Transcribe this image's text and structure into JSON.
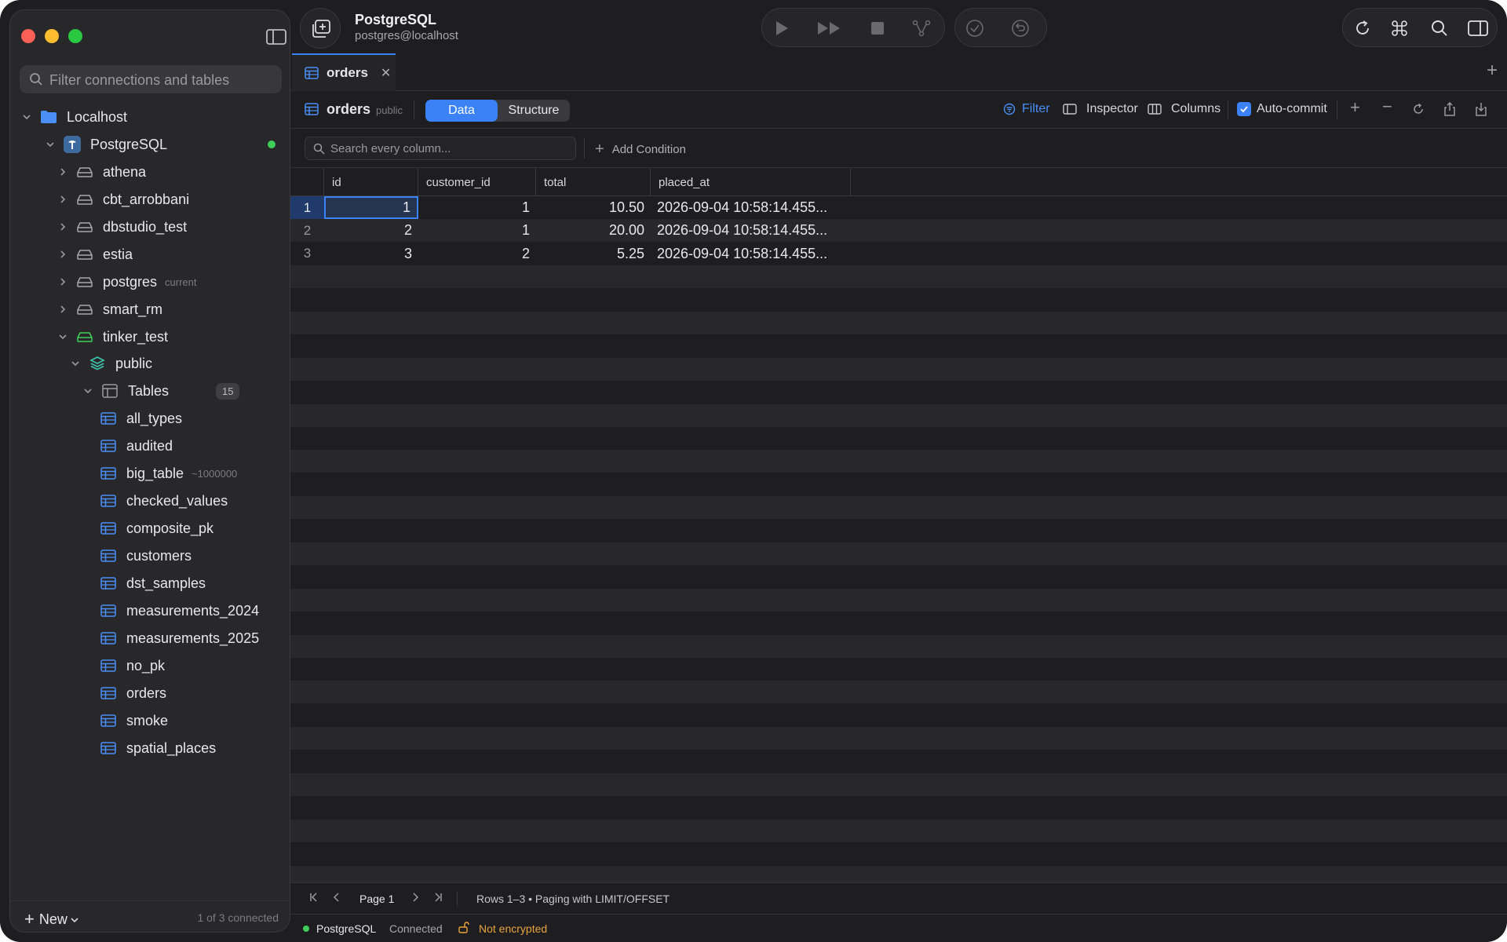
{
  "colors": {
    "accent": "#3b82f6",
    "connected": "#3fce5b",
    "warning": "#e8a33d"
  },
  "titlebar": {
    "connection_name": "PostgreSQL",
    "connection_subtitle": "postgres@localhost"
  },
  "sidebar": {
    "filter_placeholder": "Filter connections and tables",
    "group": "Localhost",
    "connection": "PostgreSQL",
    "databases": [
      {
        "name": "athena",
        "note": ""
      },
      {
        "name": "cbt_arrobbani",
        "note": ""
      },
      {
        "name": "dbstudio_test",
        "note": ""
      },
      {
        "name": "estia",
        "note": ""
      },
      {
        "name": "postgres",
        "note": "current"
      },
      {
        "name": "smart_rm",
        "note": ""
      },
      {
        "name": "tinker_test",
        "note": ""
      }
    ],
    "schema": "public",
    "tables_label": "Tables",
    "tables_count": "15",
    "tables": [
      {
        "name": "all_types",
        "note": ""
      },
      {
        "name": "audited",
        "note": ""
      },
      {
        "name": "big_table",
        "note": "~1000000"
      },
      {
        "name": "checked_values",
        "note": ""
      },
      {
        "name": "composite_pk",
        "note": ""
      },
      {
        "name": "customers",
        "note": ""
      },
      {
        "name": "dst_samples",
        "note": ""
      },
      {
        "name": "measurements_2024",
        "note": ""
      },
      {
        "name": "measurements_2025",
        "note": ""
      },
      {
        "name": "no_pk",
        "note": ""
      },
      {
        "name": "orders",
        "note": ""
      },
      {
        "name": "smoke",
        "note": ""
      },
      {
        "name": "spatial_places",
        "note": ""
      }
    ],
    "new_label": "New",
    "connected_count": "1 of 3 connected"
  },
  "tab": {
    "label": "orders"
  },
  "toolbar": {
    "table_name": "orders",
    "schema": "public",
    "data_tab": "Data",
    "structure_tab": "Structure",
    "filter": "Filter",
    "inspector": "Inspector",
    "columns": "Columns",
    "autocommit": "Auto-commit"
  },
  "search": {
    "placeholder": "Search every column...",
    "add_condition": "Add Condition"
  },
  "grid": {
    "columns": [
      "id",
      "customer_id",
      "total",
      "placed_at"
    ],
    "rows": [
      {
        "n": "1",
        "id": "1",
        "customer_id": "1",
        "total": "10.50",
        "placed_at": "2026-09-04 10:58:14.455..."
      },
      {
        "n": "2",
        "id": "2",
        "customer_id": "1",
        "total": "20.00",
        "placed_at": "2026-09-04 10:58:14.455..."
      },
      {
        "n": "3",
        "id": "3",
        "customer_id": "2",
        "total": "5.25",
        "placed_at": "2026-09-04 10:58:14.455..."
      }
    ]
  },
  "pager": {
    "page": "Page 1",
    "info": "Rows 1–3 • Paging with LIMIT/OFFSET"
  },
  "status": {
    "connection": "PostgreSQL",
    "state": "Connected",
    "encryption": "Not encrypted"
  }
}
